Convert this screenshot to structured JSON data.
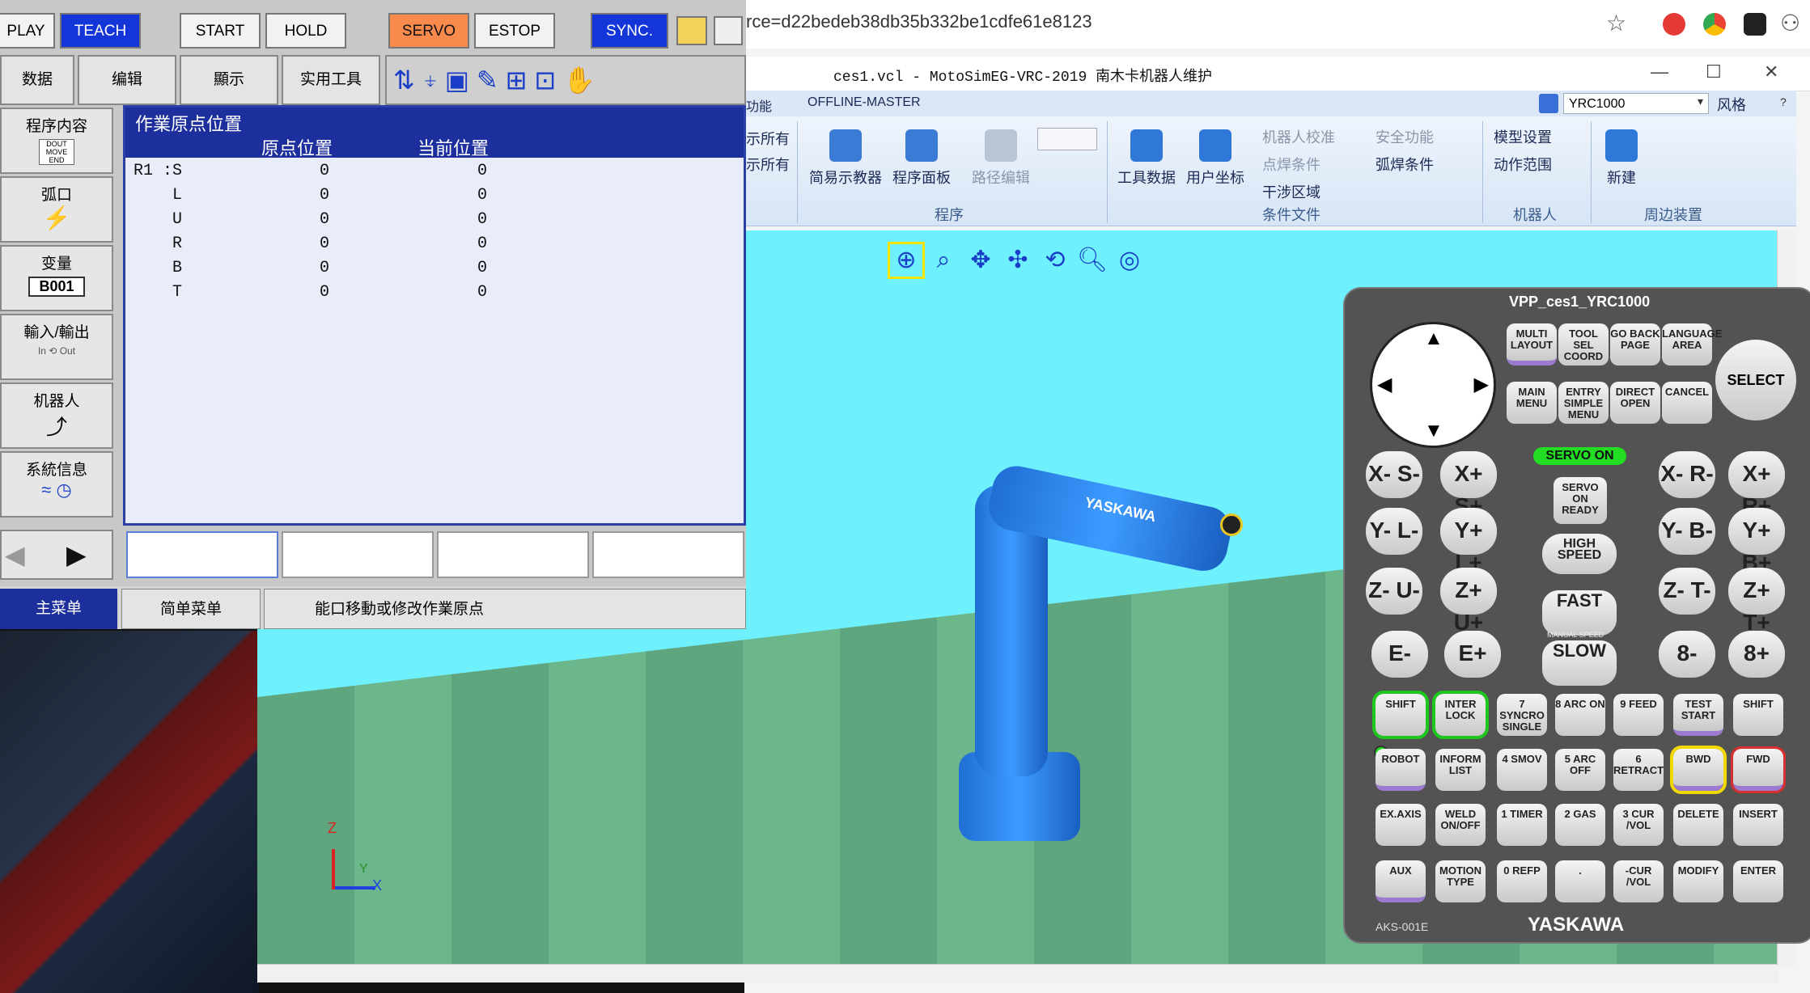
{
  "browser": {
    "url": "rce=d22bedeb38db35b332be1cdfe61e8123"
  },
  "motosim": {
    "title": "ces1.vcl - MotoSimEG-VRC-2019  南木卡机器人维护",
    "tab_partial": "功能",
    "tab_offline": "OFFLINE-MASTER",
    "controller_select": "YRC1000",
    "style_label": "风格",
    "left_stub_1": "示所有",
    "left_stub_2": "示所有",
    "ribbon": {
      "simple_teach": "简易示教器",
      "program_panel": "程序面板",
      "path_edit": "路径编辑",
      "group_program": "程序",
      "tool_data": "工具数据",
      "user_coord": "用户坐标",
      "robot_calib": "机器人校准",
      "safety": "安全功能",
      "spot_cond": "点焊条件",
      "arc_cond": "弧焊条件",
      "interference": "干涉区域",
      "group_condition": "条件文件",
      "model_setting": "模型设置",
      "motion_range": "动作范围",
      "group_robot": "机器人",
      "new": "新建",
      "group_periph": "周边装置"
    }
  },
  "pendant_screen": {
    "top": {
      "play": "PLAY",
      "teach": "TEACH",
      "start": "START",
      "hold": "HOLD",
      "servo_on": "SERVO ON",
      "estop": "ESTOP",
      "sync": "SYNC."
    },
    "menu": {
      "data": "数据",
      "edit": "编辑",
      "display": "顯示",
      "utility": "实用工具"
    },
    "side": {
      "job": "程序内容",
      "job_sub": "DOUT MOVE END",
      "arc": "弧口",
      "variable": "变量",
      "variable_val": "B001",
      "io": "輸入/輸出",
      "io_in": "In",
      "io_out": "Out",
      "robot": "机器人",
      "sysinfo": "系統信息"
    },
    "panel_title": "作業原点位置",
    "col_home": "原点位置",
    "col_current": "当前位置",
    "rows": [
      {
        "axis": "R1 :S",
        "home": "0",
        "current": "0"
      },
      {
        "axis": "L",
        "home": "0",
        "current": "0"
      },
      {
        "axis": "U",
        "home": "0",
        "current": "0"
      },
      {
        "axis": "R",
        "home": "0",
        "current": "0"
      },
      {
        "axis": "B",
        "home": "0",
        "current": "0"
      },
      {
        "axis": "T",
        "home": "0",
        "current": "0"
      }
    ],
    "bottom": {
      "main_menu": "主菜单",
      "simple_menu": "简单菜单",
      "status": "能口移動或修改作業原点"
    }
  },
  "vpp": {
    "title": "VPP_ces1_YRC1000",
    "select": "SELECT",
    "model": "AKS-001E",
    "brand": "YASKAWA",
    "servo_on": "SERVO ON",
    "keys": {
      "layout": "MULTI LAYOUT",
      "coord": "TOOL SEL COORD",
      "page": "GO BACK PAGE",
      "area": "LANGUAGE AREA",
      "main_menu": "MAIN MENU",
      "simple_menu": "ENTRY SIMPLE MENU",
      "direct_open": "DIRECT OPEN",
      "cancel": "CANCEL",
      "servo_ready": "SERVO ON READY",
      "high_speed": "HIGH SPEED",
      "fast": "FAST",
      "manual_speed": "MANUAL SPEED",
      "slow": "SLOW",
      "xm": "X- S-",
      "xp": "X+ S+",
      "ym": "Y- L-",
      "yp": "Y+ L+",
      "zm": "Z- U-",
      "zp": "Z+ U+",
      "em": "E-",
      "ep": "E+",
      "rxm": "X- R-",
      "rxp": "X+ R+",
      "rym": "Y- B-",
      "ryp": "Y+ B+",
      "rzm": "Z- T-",
      "rzp": "Z+ T+",
      "m8": "8-",
      "p8": "8+",
      "shift": "SHIFT",
      "interlock": "INTER LOCK",
      "k7": "7 SYNCRO SINGLE",
      "k8": "8 ARC ON",
      "k9": "9 FEED",
      "test_start": "TEST START",
      "shift2": "SHIFT",
      "robot": "ROBOT",
      "inform": "INFORM LIST",
      "k4": "4 SMOV",
      "k5": "5 ARC OFF",
      "k6": "6 RETRACT",
      "bwd": "BWD",
      "fwd": "FWD",
      "exaxis": "EX.AXIS",
      "weld": "WELD ON/OFF",
      "k1": "1 TIMER",
      "k2": "2 GAS",
      "k3": "3 CUR /VOL",
      "delete": "DELETE",
      "insert": "INSERT",
      "aux": "AUX",
      "motion": "MOTION TYPE",
      "k0": "0 REFP",
      "dot": ".",
      "curvol": "-CUR /VOL",
      "modify": "MODIFY",
      "enter": "ENTER"
    }
  },
  "axes": {
    "x": "X",
    "y": "Y",
    "z": "Z"
  },
  "robot_brand": "YASKAWA"
}
